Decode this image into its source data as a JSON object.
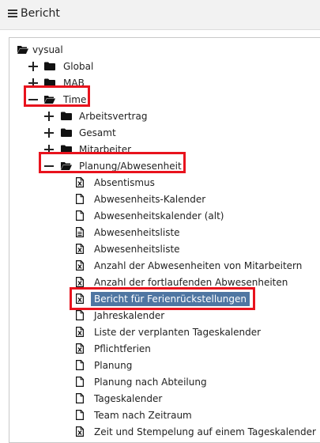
{
  "header": {
    "title": "Bericht",
    "menu_icon": "hamburger-menu-icon"
  },
  "tree": {
    "root": {
      "label": "vysual",
      "state": "expanded"
    },
    "level1": [
      {
        "label": "Global",
        "state": "collapsed"
      },
      {
        "label": "MAB",
        "state": "collapsed"
      },
      {
        "label": "Time",
        "state": "expanded",
        "highlighted": true
      }
    ],
    "time_children": [
      {
        "label": "Arbeitsvertrag",
        "state": "collapsed"
      },
      {
        "label": "Gesamt",
        "state": "collapsed"
      },
      {
        "label": "Mitarbeiter",
        "state": "collapsed"
      },
      {
        "label": "Planung/Abwesenheit",
        "state": "expanded",
        "highlighted": true
      }
    ],
    "reports": [
      {
        "label": "Absentismus",
        "icon": "excel-report-icon"
      },
      {
        "label": "Abwesenheits-Kalender",
        "icon": "document-icon"
      },
      {
        "label": "Abwesenheitskalender (alt)",
        "icon": "document-icon"
      },
      {
        "label": "Abwesenheitsliste",
        "icon": "text-report-icon"
      },
      {
        "label": "Abwesenheitsliste",
        "icon": "excel-report-icon"
      },
      {
        "label": "Anzahl der Abwesenheiten von Mitarbeitern",
        "icon": "excel-report-icon"
      },
      {
        "label": "Anzahl der fortlaufenden Abwesenheiten",
        "icon": "excel-report-icon"
      },
      {
        "label": "Bericht für Ferienrückstellungen",
        "icon": "excel-report-icon",
        "selected": true,
        "highlighted": true
      },
      {
        "label": "Jahreskalender",
        "icon": "document-icon"
      },
      {
        "label": "Liste der verplanten Tageskalender",
        "icon": "excel-report-icon"
      },
      {
        "label": "Pflichtferien",
        "icon": "excel-report-icon"
      },
      {
        "label": "Planung",
        "icon": "document-icon"
      },
      {
        "label": "Planung nach Abteilung",
        "icon": "document-icon"
      },
      {
        "label": "Tageskalender",
        "icon": "document-icon"
      },
      {
        "label": "Team nach Zeitraum",
        "icon": "document-icon"
      },
      {
        "label": "Zeit und Stempelung auf einem Tageskalender",
        "icon": "excel-report-icon"
      }
    ]
  },
  "colors": {
    "selection": "#4f76a2",
    "highlight_box": "#e8131d",
    "header_bg": "#f2f2f2"
  }
}
